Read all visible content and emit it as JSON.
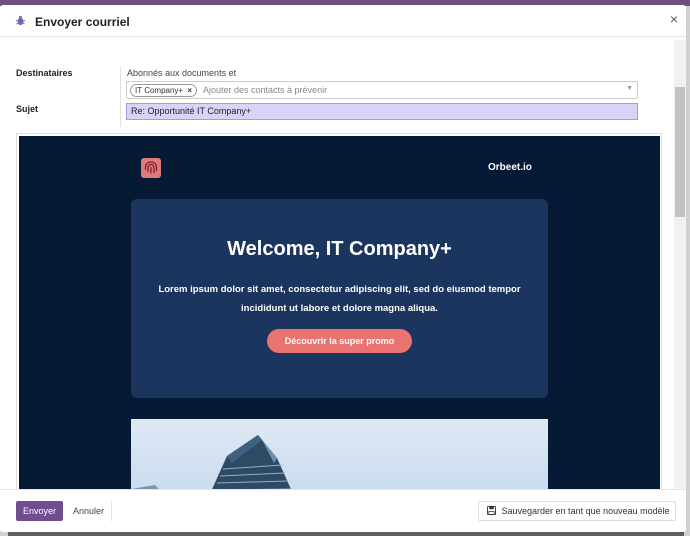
{
  "dialog": {
    "title": "Envoyer courriel",
    "close_symbol": "×"
  },
  "form": {
    "recipients_label": "Destinataires",
    "subscribers_text": "Abonnés aux documents et",
    "recipient_tag": "IT Company+",
    "recipient_tag_remove": "×",
    "recipients_placeholder": "Ajouter des contacts à prévenir",
    "dropdown_caret": "▼",
    "subject_label": "Sujet",
    "subject_value": "Re: Opportunité IT Company+"
  },
  "email": {
    "brand": "Orbeet.io",
    "hero_title": "Welcome, IT Company+",
    "hero_text": "Lorem ipsum dolor sit amet, consectetur adipiscing elit, sed do eiusmod tempor incididunt ut labore et dolore magna aliqua.",
    "cta_label": "Découvrir la super promo",
    "colors": {
      "background": "#071a35",
      "card": "#1b355e",
      "cta": "#e87370"
    }
  },
  "footer": {
    "send_label": "Envoyer",
    "cancel_label": "Annuler",
    "save_template_label": "Sauvegarder en tant que nouveau modèle"
  },
  "icons": {
    "header": "bug-icon",
    "logo": "fingerprint-icon",
    "save": "floppy-disk-icon"
  },
  "accent_color": "#6e4e8e"
}
